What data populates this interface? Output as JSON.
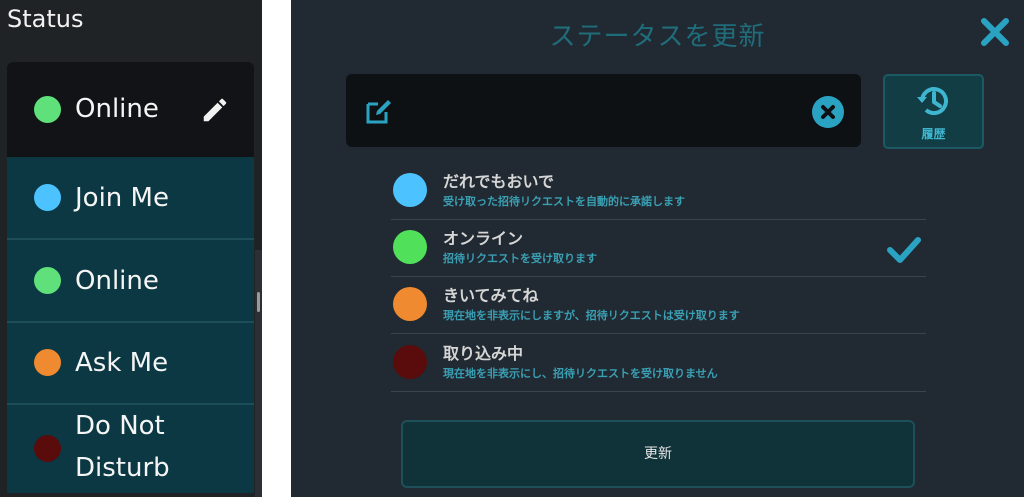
{
  "left": {
    "title": "Status",
    "current": {
      "label": "Online",
      "color": "#5fe07a"
    },
    "items": [
      {
        "label": "Join Me",
        "color": "#4cc3ff"
      },
      {
        "label": "Online",
        "color": "#5fe07a"
      },
      {
        "label": "Ask Me",
        "color": "#f08a30"
      },
      {
        "label_line1": "Do Not",
        "label_line2": "Disturb",
        "color": "#5a0b0b"
      }
    ]
  },
  "dialog": {
    "title": "ステータスを更新",
    "input": {
      "value": "",
      "placeholder": ""
    },
    "history_label": "履歴",
    "options": [
      {
        "name": "だれでもおいで",
        "desc": "受け取った招待リクエストを自動的に承諾します",
        "color": "#4cc3ff",
        "selected": false
      },
      {
        "name": "オンライン",
        "desc": "招待リクエストを受け取ります",
        "color": "#51e05a",
        "selected": true
      },
      {
        "name": "きいてみてね",
        "desc": "現在地を非表示にしますが、招待リクエストは受け取ります",
        "color": "#f08a30",
        "selected": false
      },
      {
        "name": "取り込み中",
        "desc": "現在地を非表示にし、招待リクエストを受け取りません",
        "color": "#5a0b0b",
        "selected": false
      }
    ],
    "update_label": "更新",
    "accent": "#2aa3c3"
  }
}
